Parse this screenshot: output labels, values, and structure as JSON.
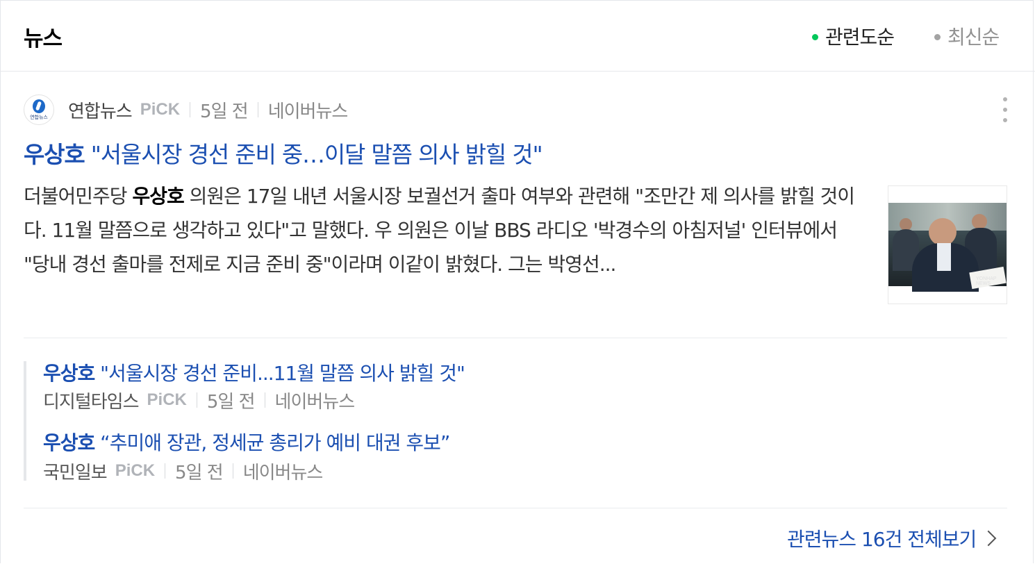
{
  "section": {
    "title": "뉴스"
  },
  "sort": {
    "relevance": "관련도순",
    "latest": "최신순",
    "active_color": "#03c75a"
  },
  "main_article": {
    "press": "연합뉴스",
    "press_logo_text": "연합뉴스",
    "pick": "PiCK",
    "time": "5일 전",
    "source": "네이버뉴스",
    "title_keyword": "우상호",
    "title_rest": " \"서울시장 경선 준비 중…이달 말쯤 의사 밝힐 것\"",
    "summary_pre": "더불어민주당 ",
    "summary_keyword": "우상호",
    "summary_post": " 의원은 17일 내년 서울시장 보궐선거 출마 여부와 관련해 \"조만간 제 의사를 밝힐 것이다. 11월 말쯤으로 생각하고 있다\"고 말했다. 우 의원은 이날 BBS 라디오 '박경수의 아침저널' 인터뷰에서 \"당내 경선 출마를 전제로 지금 준비 중\"이라며 이같이 밝혔다. 그는 박영선...",
    "thumbnail_watermark": "YONHAP NEWS"
  },
  "related": [
    {
      "title_keyword": "우상호",
      "title_rest": " \"서울시장 경선 준비...11월 말쯤 의사 밝힐 것\"",
      "press": "디지털타임스",
      "pick": "PiCK",
      "time": "5일 전",
      "source": "네이버뉴스"
    },
    {
      "title_keyword": "우상호",
      "title_rest": " “추미애 장관, 정세균 총리가 예비 대권 후보”",
      "press": "국민일보",
      "pick": "PiCK",
      "time": "5일 전",
      "source": "네이버뉴스"
    }
  ],
  "footer": {
    "all_news": "관련뉴스 16건 전체보기"
  },
  "colors": {
    "link": "#1b4fb1",
    "divider": "#e9ebee"
  }
}
